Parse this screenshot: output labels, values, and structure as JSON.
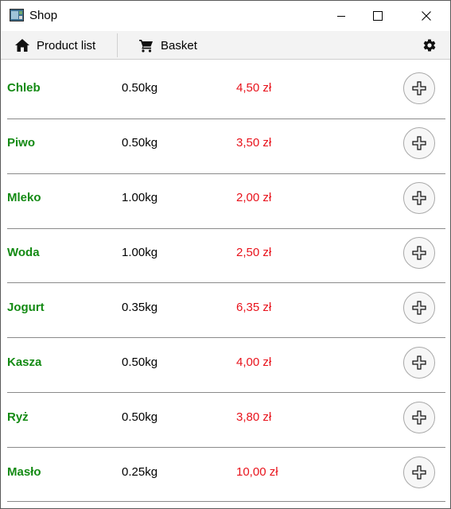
{
  "window": {
    "title": "Shop"
  },
  "toolbar": {
    "product_list_label": "Product list",
    "basket_label": "Basket"
  },
  "products": [
    {
      "name": "Chleb",
      "weight": "0.50kg",
      "price": "4,50 zł"
    },
    {
      "name": "Piwo",
      "weight": "0.50kg",
      "price": "3,50 zł"
    },
    {
      "name": "Mleko",
      "weight": "1.00kg",
      "price": "2,00 zł"
    },
    {
      "name": "Woda",
      "weight": "1.00kg",
      "price": "2,50 zł"
    },
    {
      "name": "Jogurt",
      "weight": "0.35kg",
      "price": "6,35 zł"
    },
    {
      "name": "Kasza",
      "weight": "0.50kg",
      "price": "4,00 zł"
    },
    {
      "name": "Ryż",
      "weight": "0.50kg",
      "price": "3,80 zł"
    },
    {
      "name": "Masło",
      "weight": "0.25kg",
      "price": "10,00 zł"
    }
  ],
  "colors": {
    "name": "#138a13",
    "price": "#e8121b"
  },
  "icons": {
    "home": "home-icon",
    "basket": "cart-icon",
    "settings": "gear-icon",
    "add": "plus-icon"
  }
}
